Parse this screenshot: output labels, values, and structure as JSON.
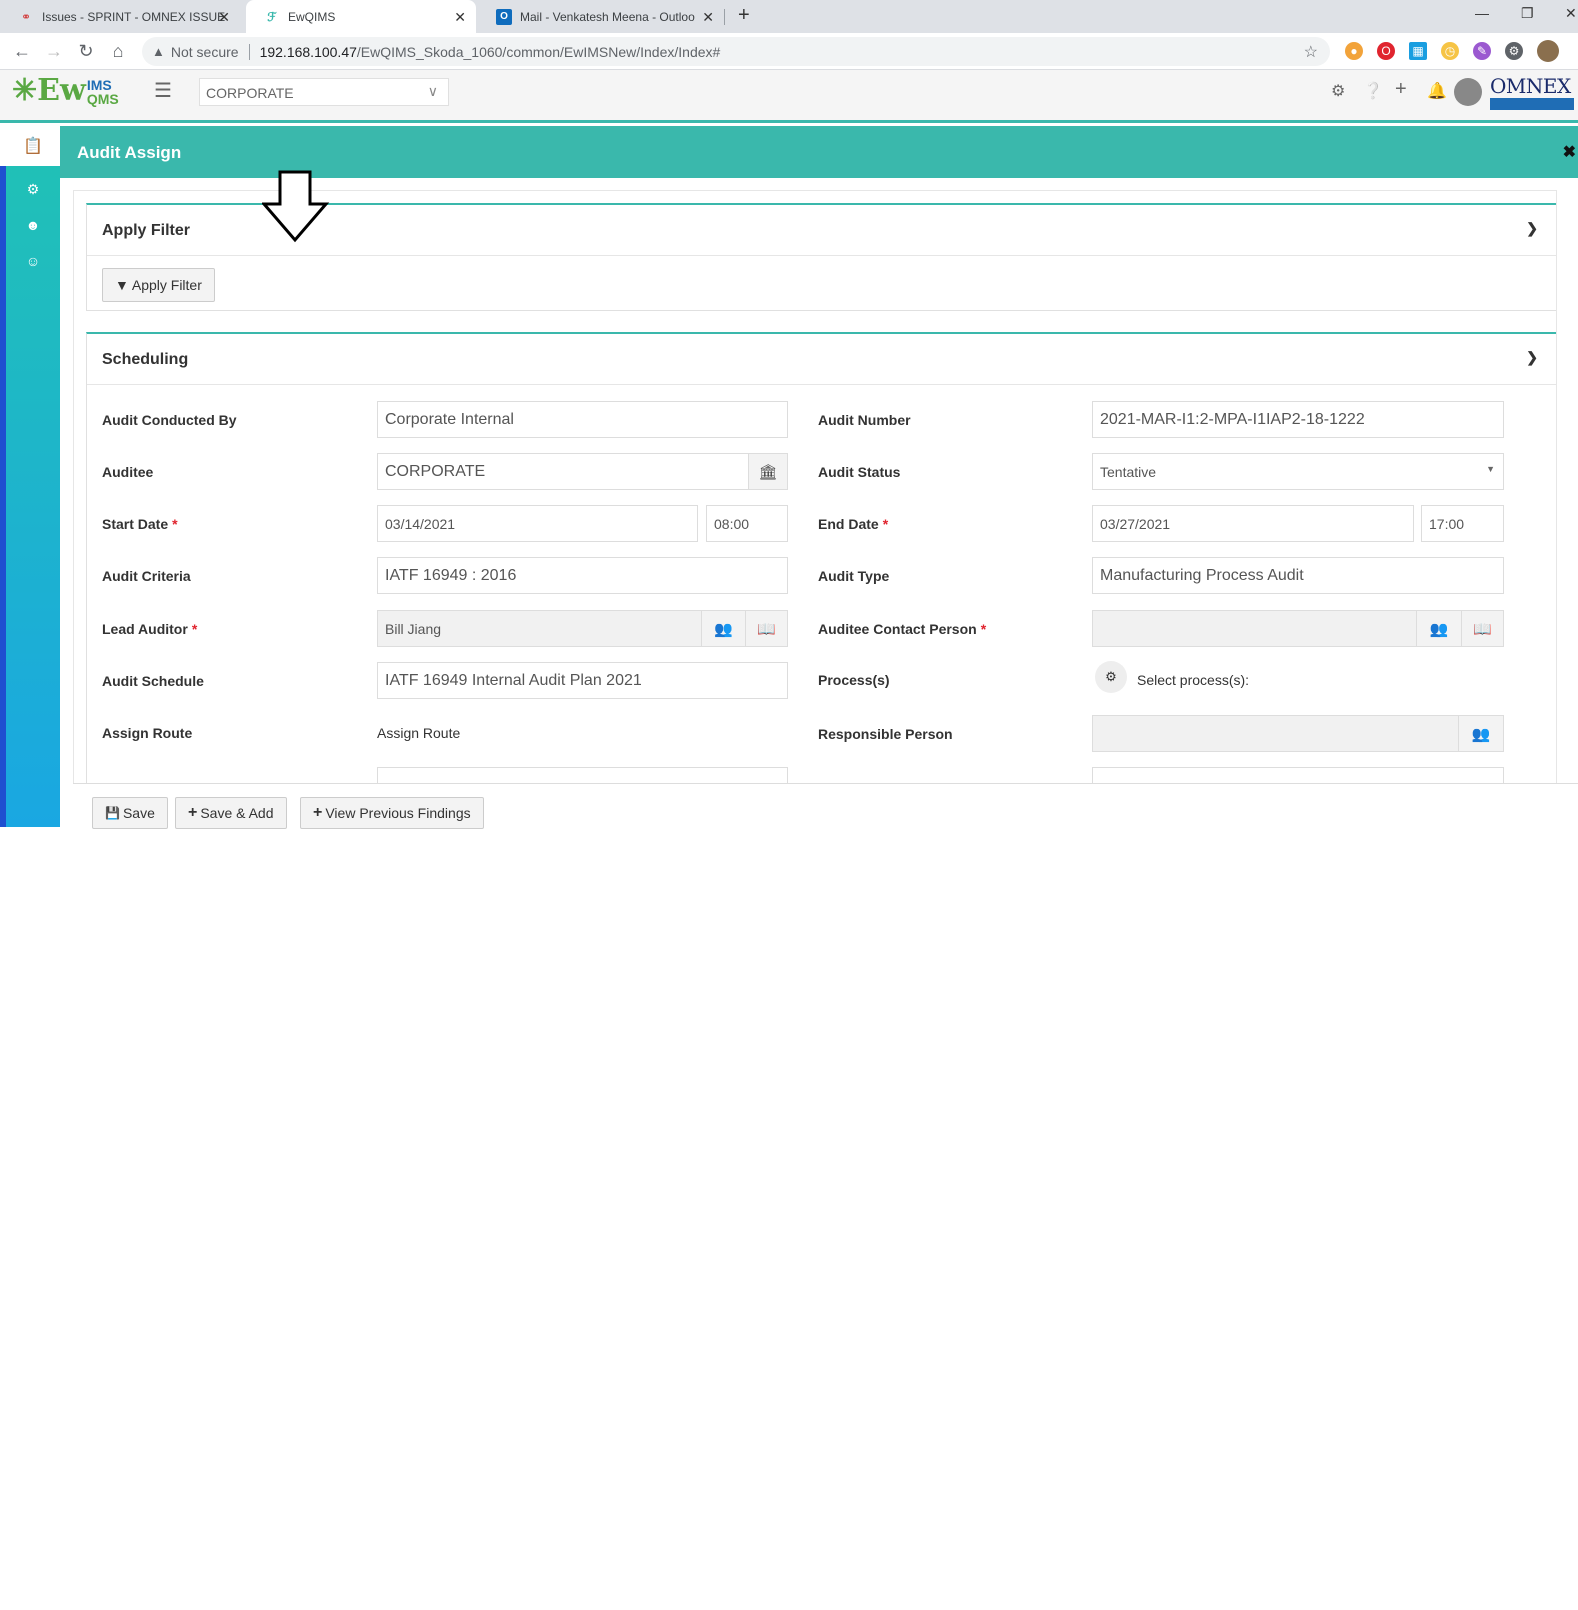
{
  "browser": {
    "tabs": [
      {
        "title": "Issues - SPRINT - OMNEX ISSUE",
        "active": false
      },
      {
        "title": "EwQIMS",
        "active": true
      },
      {
        "title": "Mail - Venkatesh Meena - Outloo",
        "active": false
      }
    ],
    "security_label": "Not secure",
    "url_host": "192.168.100.47",
    "url_path": "/EwQIMS_Skoda_1060/common/EwIMSNew/Index/Index#"
  },
  "app": {
    "logo": {
      "main": "Ew",
      "top": "IMS",
      "bottom": "QMS"
    },
    "site_select": "CORPORATE",
    "brand": "OMNEX"
  },
  "panel": {
    "title": "Audit Assign"
  },
  "filter_section": {
    "title": "Apply Filter",
    "button_label": "Apply Filter"
  },
  "scheduling": {
    "title": "Scheduling",
    "audit_conducted_by": {
      "label": "Audit Conducted By",
      "value": "Corporate Internal"
    },
    "auditee": {
      "label": "Auditee",
      "value": "CORPORATE"
    },
    "start_date": {
      "label": "Start Date",
      "date": "03/14/2021",
      "time": "08:00"
    },
    "audit_criteria": {
      "label": "Audit Criteria",
      "value": "IATF 16949 : 2016"
    },
    "lead_auditor": {
      "label": "Lead Auditor",
      "value": "Bill  Jiang"
    },
    "audit_schedule": {
      "label": "Audit Schedule",
      "value": "IATF 16949 Internal Audit Plan 2021"
    },
    "assign_route": {
      "label": "Assign Route",
      "value": "Assign Route"
    },
    "audit_number": {
      "label": "Audit Number",
      "value": "2021-MAR-I1:2-MPA-I1IAP2-18-1222"
    },
    "audit_status": {
      "label": "Audit Status",
      "value": "Tentative"
    },
    "end_date": {
      "label": "End Date",
      "date": "03/27/2021",
      "time": "17:00"
    },
    "audit_type": {
      "label": "Audit Type",
      "value": "Manufacturing Process Audit"
    },
    "auditee_contact": {
      "label": "Auditee Contact Person",
      "value": ""
    },
    "processes": {
      "label": "Process(s)",
      "value": "Select process(s):"
    },
    "responsible_person": {
      "label": "Responsible Person",
      "value": ""
    },
    "required_mark": "*"
  },
  "footer": {
    "save": "Save",
    "save_add": "Save & Add",
    "view_prev": "View Previous Findings"
  },
  "colors": {
    "accent": "#3ab8ac",
    "sidebar_top": "#21c2b4",
    "sidebar_bottom": "#1aa7e2",
    "required": "#e0242e"
  }
}
